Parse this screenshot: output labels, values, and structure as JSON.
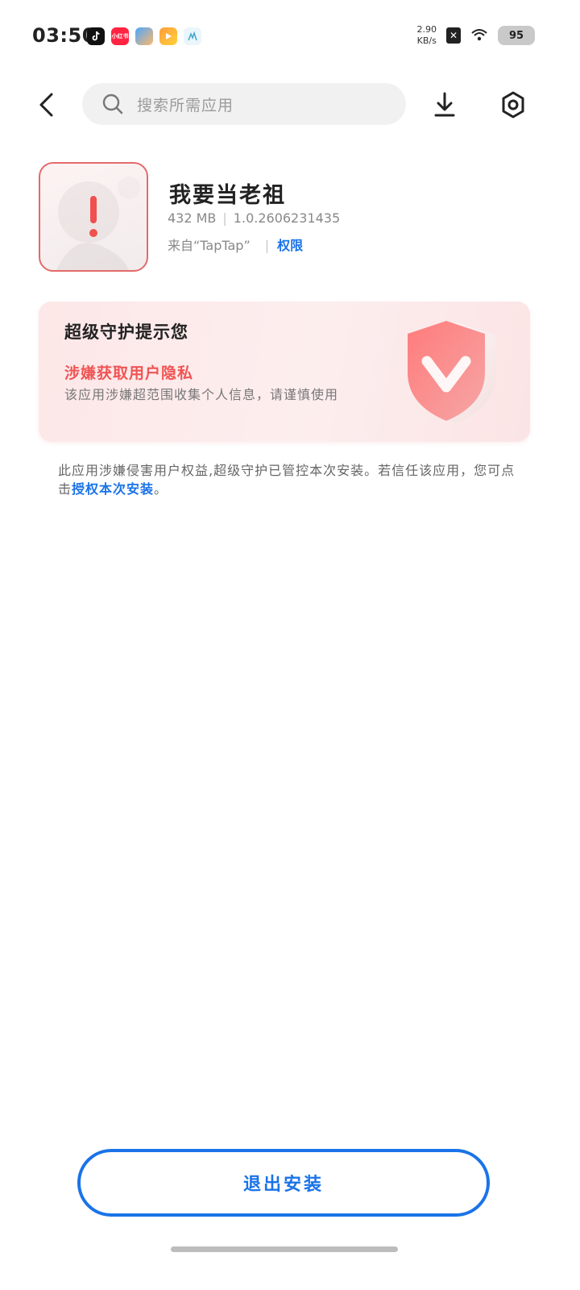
{
  "status_bar": {
    "time": "03:50",
    "app_icons": [
      {
        "icon": "tiktok-icon",
        "label": ""
      },
      {
        "icon": "xiaohongshu-icon",
        "label": "小红书"
      },
      {
        "icon": "app-blue-icon",
        "label": ""
      },
      {
        "icon": "app-play-icon",
        "label": ""
      },
      {
        "icon": "app-soft-icon",
        "label": ""
      }
    ],
    "net_speed": "2.90",
    "net_unit": "KB/s",
    "battery": "95"
  },
  "topbar": {
    "search_placeholder": "搜索所需应用"
  },
  "app": {
    "name": "我要当老祖",
    "size": "432 MB",
    "version": "1.0.2606231435",
    "source": "来自“TapTap”",
    "permission_link": "权限"
  },
  "warning_card": {
    "title": "超级守护提示您",
    "risk": "涉嫌获取用户隐私",
    "description": "该应用涉嫌超范围收集个人信息，请谨慎使用"
  },
  "notice": {
    "text": "此应用涉嫌侵害用户权益,超级守护已管控本次安装。若信任该应用，您可点击",
    "link": "授权本次安装",
    "end": "。"
  },
  "exit_button": "退出安装",
  "colors": {
    "accent": "#1a73e8",
    "risk": "#f05454",
    "card_bg": "#fde7e8"
  }
}
